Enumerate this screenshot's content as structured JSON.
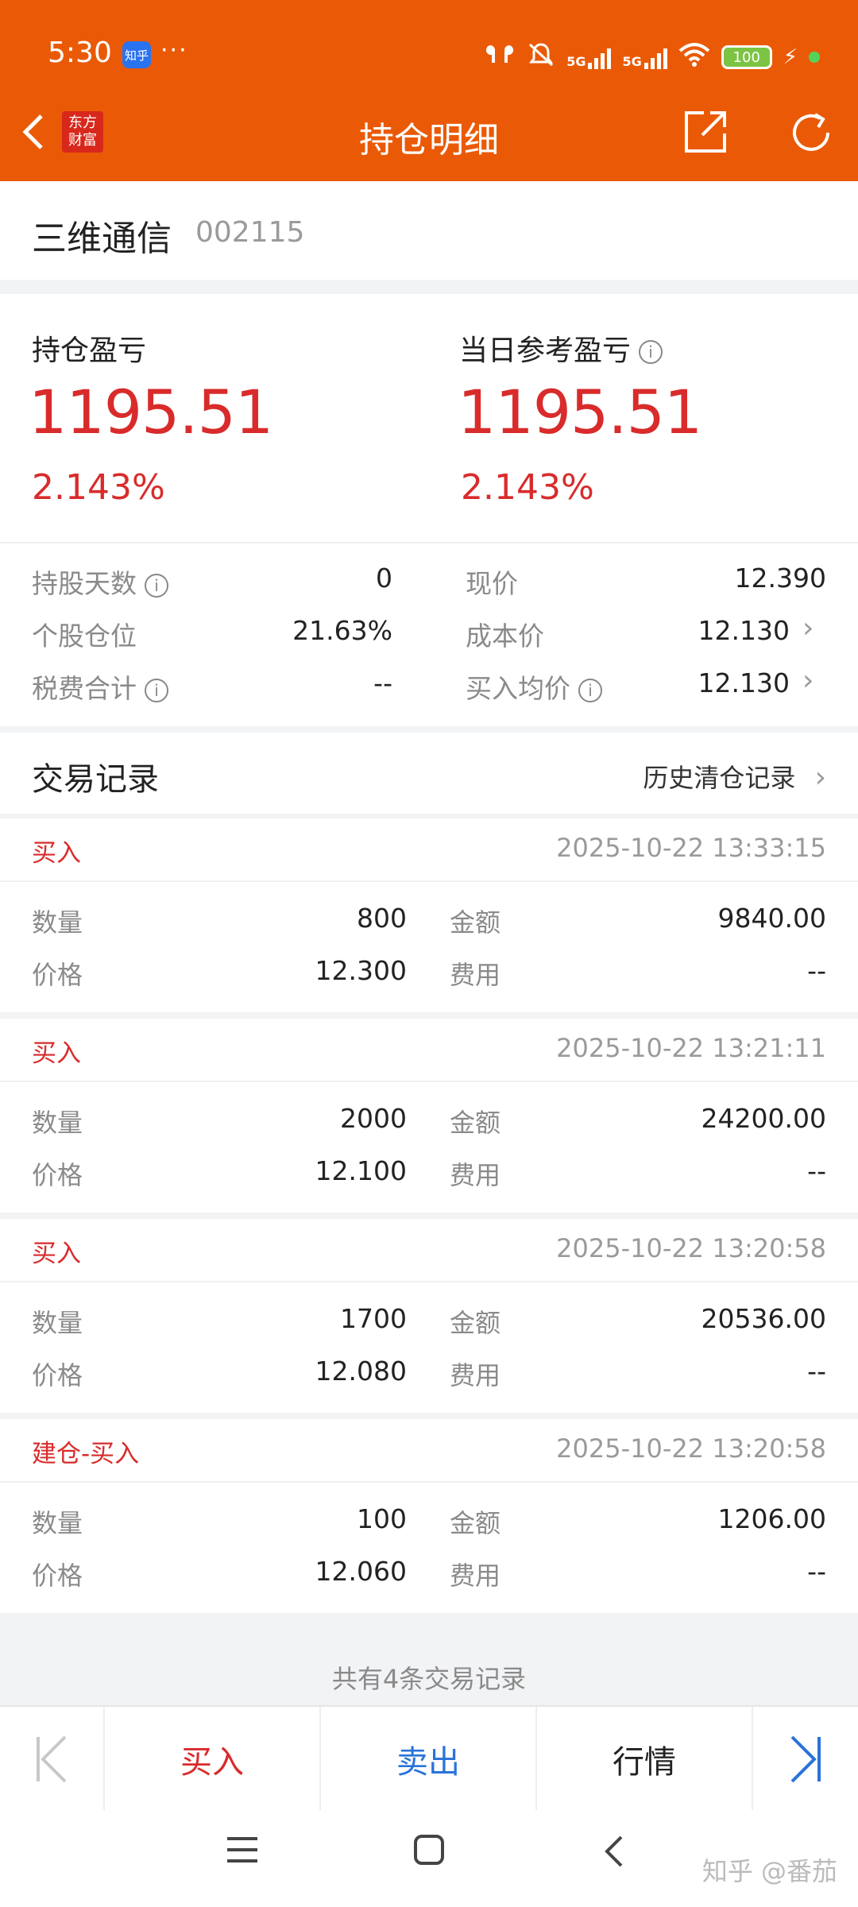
{
  "status_bar": {
    "time": "5:30",
    "app_badge": "知乎",
    "dots": "···",
    "battery": "100"
  },
  "header": {
    "logo_text_line1": "东方",
    "logo_text_line2": "财富",
    "title": "持仓明细",
    "colors": {
      "accent": "#ea5a06"
    }
  },
  "stock": {
    "name": "三维通信",
    "code": "002115"
  },
  "profit": {
    "position_pl_label": "持仓盈亏",
    "position_pl_value": "1195.51",
    "position_pl_pct": "2.143%",
    "daily_pl_label": "当日参考盈亏",
    "daily_pl_value": "1195.51",
    "daily_pl_pct": "2.143%"
  },
  "details": {
    "left": [
      {
        "label": "持股天数",
        "value": "0",
        "info": true
      },
      {
        "label": "个股仓位",
        "value": "21.63%",
        "info": false
      },
      {
        "label": "税费合计",
        "value": "--",
        "info": true
      }
    ],
    "right": [
      {
        "label": "现价",
        "value": "12.390",
        "info": false,
        "chevron": false
      },
      {
        "label": "成本价",
        "value": "12.130",
        "info": false,
        "chevron": true
      },
      {
        "label": "买入均价",
        "value": "12.130",
        "info": true,
        "chevron": true
      }
    ]
  },
  "trades": {
    "title": "交易记录",
    "history_link": "历史清仓记录",
    "labels": {
      "qty": "数量",
      "price": "价格",
      "amount": "金额",
      "fee": "费用"
    },
    "records": [
      {
        "type": "买入",
        "time": "2025-10-22 13:33:15",
        "qty": "800",
        "price": "12.300",
        "amount": "9840.00",
        "fee": "--"
      },
      {
        "type": "买入",
        "time": "2025-10-22 13:21:11",
        "qty": "2000",
        "price": "12.100",
        "amount": "24200.00",
        "fee": "--"
      },
      {
        "type": "买入",
        "time": "2025-10-22 13:20:58",
        "qty": "1700",
        "price": "12.080",
        "amount": "20536.00",
        "fee": "--"
      },
      {
        "type": "建仓-买入",
        "time": "2025-10-22 13:20:58",
        "qty": "100",
        "price": "12.060",
        "amount": "1206.00",
        "fee": "--"
      }
    ],
    "summary": "共有4条交易记录"
  },
  "actions": {
    "buy": "买入",
    "sell": "卖出",
    "quote": "行情"
  },
  "watermark": "知乎 @番茄"
}
